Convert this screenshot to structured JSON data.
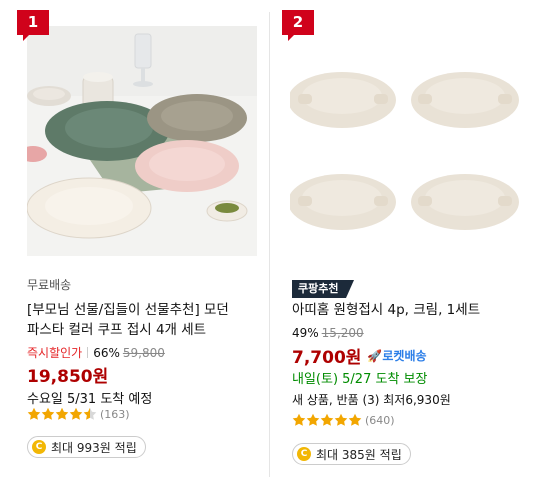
{
  "products": [
    {
      "rank": "1",
      "free_shipping": "무료배송",
      "title_line1": "[부모님 선물/집들이 선물추천] 모던",
      "title_line2": "파스타 컬러 쿠프 접시 4개 세트",
      "discount_label": "즉시할인가",
      "discount_pct": "66%",
      "original_price": "59,800",
      "price": "19,850원",
      "delivery": "수요일 5/31 도착 예정",
      "rating": 4.5,
      "review_count": "(163)",
      "reward": "최대 993원 적립"
    },
    {
      "rank": "2",
      "badge": "쿠팡추천",
      "title_line1": "아띠홈 원형접시 4p, 크림, 1세트",
      "discount_pct": "49%",
      "original_price": "15,200",
      "price": "7,700원",
      "rocket_label": "로켓배송",
      "delivery": "내일(토) 5/27 도착 보장",
      "new_used": "새 상품, 반품 (3) 최저6,930원",
      "rating": 5,
      "review_count": "(640)",
      "reward": "최대 385원 적립"
    }
  ],
  "colors": {
    "rank_red": "#d0021b",
    "price": "#ae0000",
    "sale_label": "#e52528",
    "delivery_green": "#008c00",
    "star": "#f2a600",
    "rocket_blue": "#2b7ee8",
    "badge_bg": "#1c2a3a"
  }
}
